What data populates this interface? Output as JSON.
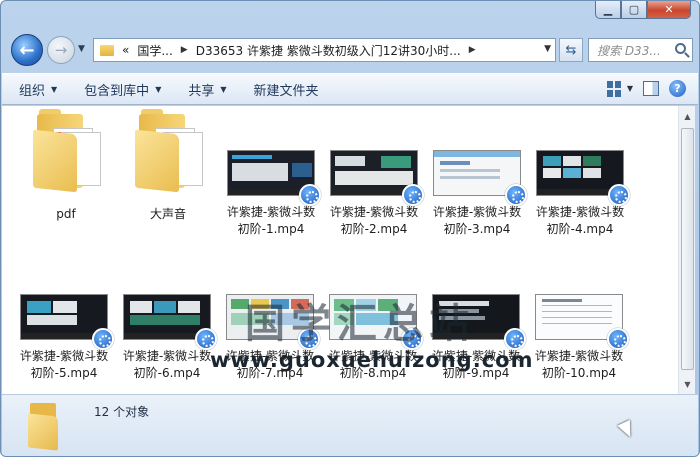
{
  "window": {
    "caption_buttons": [
      "minimize",
      "maximize",
      "close"
    ]
  },
  "nav": {
    "address": {
      "prefix": "«",
      "crumbs": [
        "国学...",
        "D33653 许紫捷 紫微斗数初级入门12讲30小时..."
      ]
    },
    "search_placeholder": "搜索 D33..."
  },
  "toolbar": {
    "items": [
      {
        "label": "组织",
        "has_dropdown": true
      },
      {
        "label": "包含到库中",
        "has_dropdown": true
      },
      {
        "label": "共享",
        "has_dropdown": true
      },
      {
        "label": "新建文件夹",
        "has_dropdown": false
      }
    ],
    "help": "?"
  },
  "files": [
    {
      "name": "pdf",
      "type": "folder"
    },
    {
      "name": "大声音",
      "type": "folder"
    },
    {
      "name": "许紫捷-紫微斗数初阶-1.mp4",
      "type": "video"
    },
    {
      "name": "许紫捷-紫微斗数初阶-2.mp4",
      "type": "video"
    },
    {
      "name": "许紫捷-紫微斗数初阶-3.mp4",
      "type": "video"
    },
    {
      "name": "许紫捷-紫微斗数初阶-4.mp4",
      "type": "video"
    },
    {
      "name": "许紫捷-紫微斗数初阶-5.mp4",
      "type": "video"
    },
    {
      "name": "许紫捷-紫微斗数初阶-6.mp4",
      "type": "video"
    },
    {
      "name": "许紫捷-紫微斗数初阶-7.mp4",
      "type": "video"
    },
    {
      "name": "许紫捷-紫微斗数初阶-8.mp4",
      "type": "video"
    },
    {
      "name": "许紫捷-紫微斗数初阶-9.mp4",
      "type": "video"
    },
    {
      "name": "许紫捷-紫微斗数初阶-10.mp4",
      "type": "video"
    }
  ],
  "labels": {
    "pdf": "pdf",
    "dsy": "大声音",
    "v1a": "许紫捷-紫微斗数",
    "v1b": "初阶-1.mp4",
    "v2a": "许紫捷-紫微斗数",
    "v2b": "初阶-2.mp4",
    "v3a": "许紫捷-紫微斗数",
    "v3b": "初阶-3.mp4",
    "v4a": "许紫捷-紫微斗数",
    "v4b": "初阶-4.mp4",
    "v5a": "许紫捷-紫微斗数",
    "v5b": "初阶-5.mp4",
    "v6a": "许紫捷-紫微斗数",
    "v6b": "初阶-6.mp4",
    "v7a": "许紫捷-紫微斗数",
    "v7b": "初阶-7.mp4",
    "v8a": "许紫捷-紫微斗数",
    "v8b": "初阶-8.mp4",
    "v9a": "许紫捷-紫微斗数",
    "v9b": "初阶-9.mp4",
    "v10a": "许紫捷-紫微斗数",
    "v10b": "初阶-10.mp4"
  },
  "watermark": {
    "line1": "国学汇总站",
    "line2": "www.guoxuehuizong.com"
  },
  "status": {
    "count_text": "12 个对象"
  },
  "colors": {
    "window_frame": "#bcd3ec",
    "folder_yellow": "#f6d67a",
    "player_blue": "#1a56b8",
    "close_red": "#c8462c"
  }
}
